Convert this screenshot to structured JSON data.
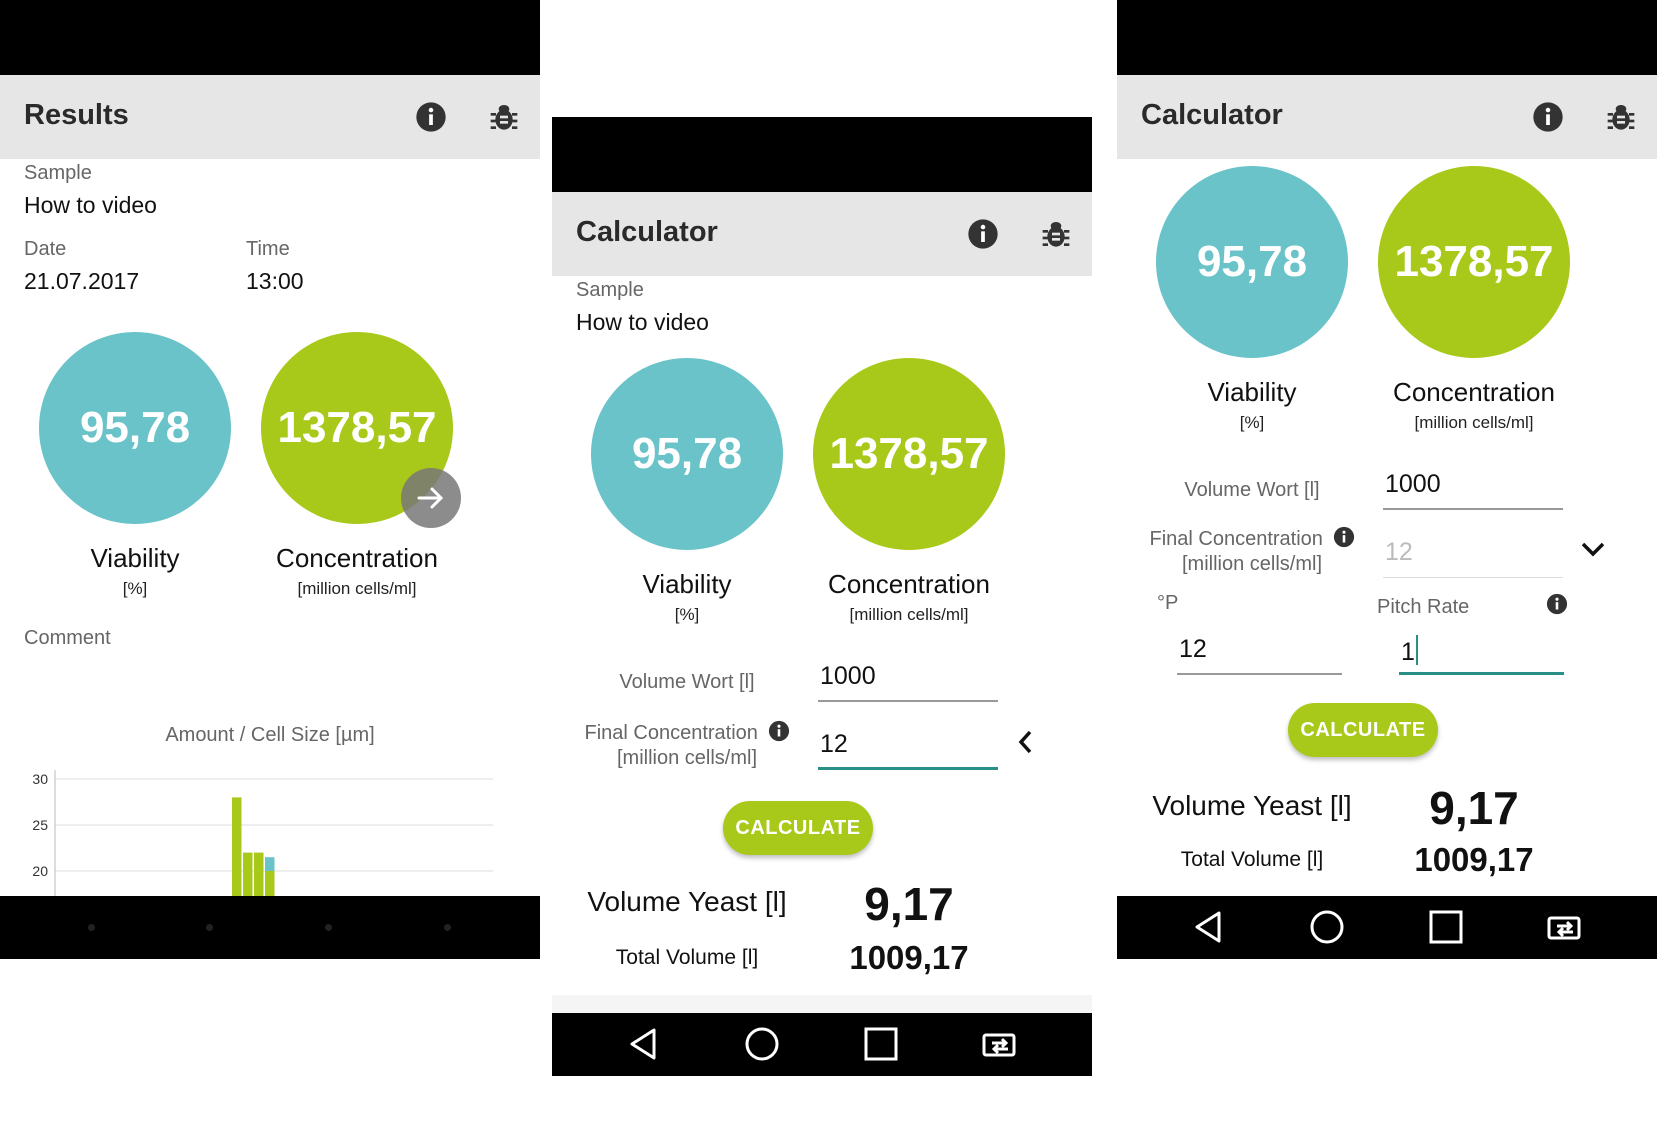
{
  "results_screen": {
    "title": "Results",
    "sample_label": "Sample",
    "sample_value": "How to video",
    "date_label": "Date",
    "date_value": "21.07.2017",
    "time_label": "Time",
    "time_value": "13:00",
    "viability_value": "95,78",
    "viability_label": "Viability",
    "viability_unit": "[%]",
    "concentration_value": "1378,57",
    "concentration_label": "Concentration",
    "concentration_unit": "[million cells/ml]",
    "comment_label": "Comment",
    "chart_title": "Amount / Cell Size [µm]"
  },
  "chart_data": {
    "type": "bar",
    "title": "Amount / Cell Size [µm]",
    "ylim": [
      20,
      30
    ],
    "yticks": [
      "30",
      "25",
      "20"
    ],
    "grid": true,
    "legend": "none",
    "series": [
      {
        "color": "#a8c919",
        "values": [
          28,
          22,
          22,
          20
        ]
      },
      {
        "color": "#6ac3c9",
        "values": [
          0,
          0,
          0,
          1.5
        ]
      }
    ]
  },
  "calculator_screen_a": {
    "title": "Calculator",
    "sample_label": "Sample",
    "sample_value": "How to video",
    "viability_value": "95,78",
    "viability_label": "Viability",
    "viability_unit": "[%]",
    "concentration_value": "1378,57",
    "concentration_label": "Concentration",
    "concentration_unit": "[million cells/ml]",
    "volume_wort_label": "Volume Wort [l]",
    "volume_wort_value": "1000",
    "final_conc_label": "Final Concentration",
    "final_conc_unit": "[million cells/ml]",
    "final_conc_value": "12",
    "calculate_label": "CALCULATE",
    "volume_yeast_label": "Volume Yeast [l]",
    "volume_yeast_value": "9,17",
    "total_volume_label": "Total Volume [l]",
    "total_volume_value": "1009,17"
  },
  "calculator_screen_b": {
    "title": "Calculator",
    "viability_value": "95,78",
    "viability_label": "Viability",
    "viability_unit": "[%]",
    "concentration_value": "1378,57",
    "concentration_label": "Concentration",
    "concentration_unit": "[million cells/ml]",
    "volume_wort_label": "Volume Wort [l]",
    "volume_wort_value": "1000",
    "final_conc_label": "Final Concentration",
    "final_conc_unit": "[million cells/ml]",
    "final_conc_value": "12",
    "plato_label": "°P",
    "plato_value": "12",
    "pitch_rate_label": "Pitch Rate",
    "pitch_rate_value": "1",
    "calculate_label": "CALCULATE",
    "volume_yeast_label": "Volume Yeast [l]",
    "volume_yeast_value": "9,17",
    "total_volume_label": "Total Volume [l]",
    "total_volume_value": "1009,17"
  },
  "icons": {
    "info": "info-icon",
    "bug": "bug-icon",
    "next": "arrow-right-icon",
    "collapse": "chevron-left-icon",
    "expand": "chevron-down-icon",
    "back": "back-triangle-icon",
    "home": "home-circle-icon",
    "recents": "recents-square-icon",
    "switch": "switch-app-icon"
  },
  "colors": {
    "viability": "#6ac3c9",
    "concentration": "#a8c919",
    "accent_input": "#2a8f86",
    "appbar": "#e6e6e6"
  }
}
